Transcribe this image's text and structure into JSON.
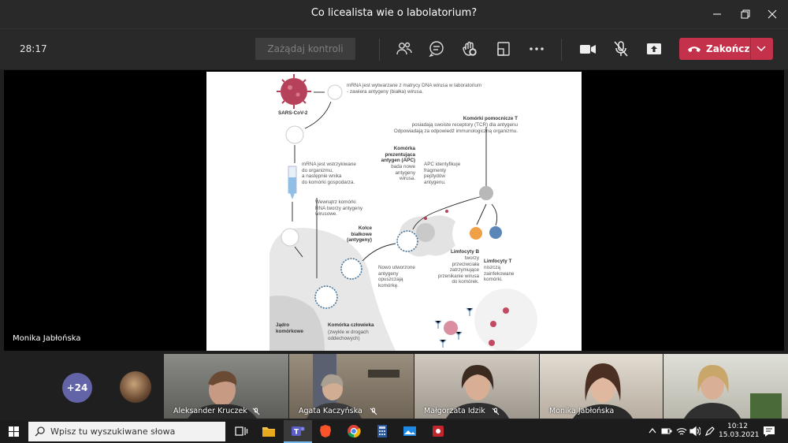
{
  "window": {
    "title": "Co licealista wie o labolatorium?"
  },
  "toolbar": {
    "timer": "28:17",
    "request_control": "Zażądaj kontroli",
    "end_call": "Zakończ"
  },
  "stage": {
    "presenter": "Monika Jabłońska"
  },
  "slide": {
    "sars": "SARS-CoV-2",
    "mrna_made": [
      "mRNA jest wytwarzane z matrycy DNA wirusa w laboratorium",
      "- zawiera antygeny (białka) wirusa."
    ],
    "helper_title": "Komórki pomocnicze T",
    "helper_text": [
      "posiadają swoiste receptory (TCR) dla antygenu",
      "Odpowiadają za odpowiedź immunologiczną organizmu."
    ],
    "apc_title": [
      "Komórka",
      "prezentująca",
      "antygen (APC)"
    ],
    "apc_text": [
      "bada nowe",
      "antygeny",
      "wirusa."
    ],
    "apc_ident": [
      "APC identyfikuje",
      "fragmenty",
      "peptydów",
      "antygenu."
    ],
    "mrna_inject": [
      "mRNA jest wstrzykiwane",
      "do organizmu,",
      "a następnie wnika",
      "do komórki gospodarza."
    ],
    "inside_cell": [
      "Wewnątrz komórki",
      "RNA tworzy antygeny",
      "wirusowe."
    ],
    "spikes_title": [
      "Kolce",
      "białkowe",
      "(antygeny)"
    ],
    "new_antigens": [
      "Nowo utworzone",
      "antygeny",
      "opuszczają",
      "komórkę."
    ],
    "b_title": "Limfocyty B",
    "b_text": [
      "tworzy",
      "przeciwciała",
      "zatrzymujące",
      "przenikanie wirusa",
      "do komórek."
    ],
    "t_title": "Limfocyty T",
    "t_text": [
      "niszczą",
      "zainfekowane",
      "komórki."
    ],
    "nucleus": [
      "Jądro",
      "komórkowe"
    ],
    "human_cell_title": "Komórka człowieka",
    "human_cell_text": [
      "(zwykle w drogach",
      "oddechowych)"
    ]
  },
  "participants": {
    "more_count": "+24",
    "tiles": [
      {
        "name": "Aleksander Kruczek"
      },
      {
        "name": "Agata Kaczyńska"
      },
      {
        "name": "Małgorzata Idzik"
      },
      {
        "name": "Monika Jabłońska"
      }
    ]
  },
  "taskbar": {
    "search_placeholder": "Wpisz tu wyszukiwane słowa",
    "time": "10:12",
    "date": "15.03.2021"
  },
  "colors": {
    "accent": "#6264a7",
    "end_call": "#c4314b",
    "virus": "#b5425a"
  }
}
